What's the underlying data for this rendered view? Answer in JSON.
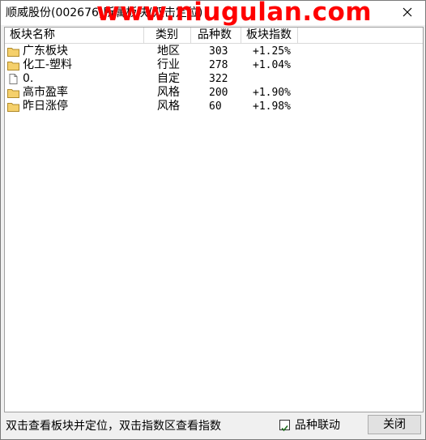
{
  "window": {
    "title": "顺威股份(002676)所属板块(双击定位)"
  },
  "watermark": "www.niugulan.com",
  "columns": [
    "板块名称",
    "类别",
    "品种数",
    "板块指数"
  ],
  "rows": [
    {
      "icon": "folder-icon",
      "name": "广东板块",
      "category": "地区",
      "count": "303",
      "index": "+1.25%"
    },
    {
      "icon": "folder-icon",
      "name": "化工-塑料",
      "category": "行业",
      "count": "278",
      "index": "+1.04%"
    },
    {
      "icon": "document-icon",
      "name": "0.",
      "category": "自定",
      "count": "322",
      "index": ""
    },
    {
      "icon": "folder-icon",
      "name": "高市盈率",
      "category": "风格",
      "count": "200",
      "index": "+1.90%"
    },
    {
      "icon": "folder-icon",
      "name": "昨日涨停",
      "category": "风格",
      "count": "60",
      "index": "+1.98%"
    }
  ],
  "status": {
    "hint": "双击查看板块并定位，双击指数区查看指数",
    "link_label": "品种联动",
    "link_checked": true,
    "close_label": "关闭"
  },
  "colors": {
    "folder": "#f5d06b",
    "watermark": "#ff0000"
  }
}
